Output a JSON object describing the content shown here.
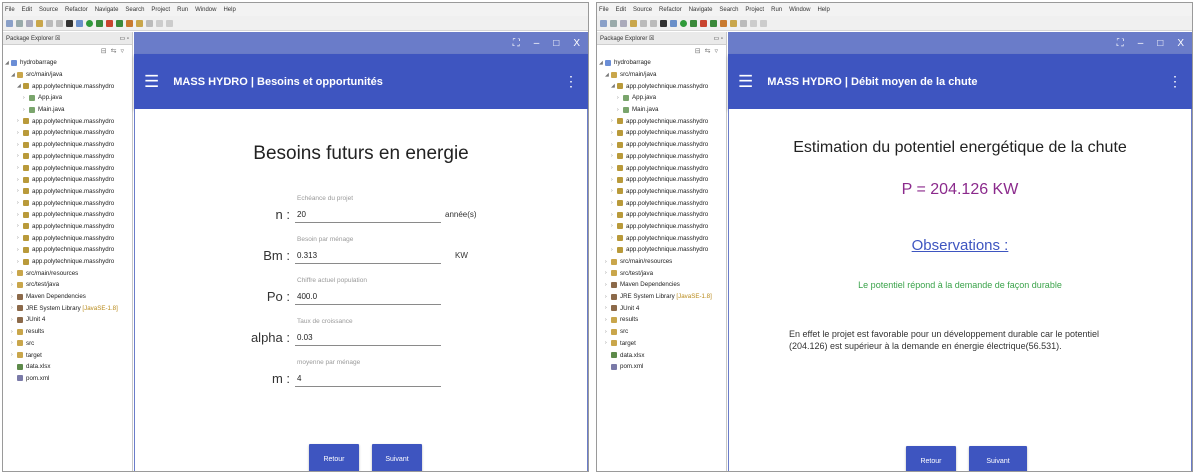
{
  "eclipse": {
    "menu": [
      "File",
      "Edit",
      "Source",
      "Refactor",
      "Navigate",
      "Search",
      "Project",
      "Run",
      "Window",
      "Help"
    ],
    "package_explorer_title": "Package Explorer ☒",
    "tree": {
      "project": "hydrobarrage",
      "src_main": "src/main/java",
      "package": "app.polytechnique.masshydro",
      "app_java": "App.java",
      "main_java": "Main.java",
      "subpackage": "app.polytechnique.masshydro",
      "resources": "src/main/resources",
      "src_test": "src/test/java",
      "maven": "Maven Dependencies",
      "jre": "JRE System Library",
      "jre_version": "[JavaSE-1.8]",
      "junit": "JUnit 4",
      "results": "results",
      "src": "src",
      "target": "target",
      "data": "data.xlsx",
      "pom": "pom.xml"
    }
  },
  "left_app": {
    "title": "MASS HYDRO | Besoins et opportunités",
    "heading": "Besoins futurs en energie",
    "fields": [
      {
        "label": "n :",
        "hint": "Echéance du projet",
        "value": "20",
        "unit": "année(s)"
      },
      {
        "label": "Bm :",
        "hint": "Besoin par ménage",
        "value": "0.313",
        "unit": "KW"
      },
      {
        "label": "Po :",
        "hint": "Chiffre actuel population",
        "value": "400.0",
        "unit": ""
      },
      {
        "label": "alpha :",
        "hint": "Taux de croissance",
        "value": "0.03",
        "unit": ""
      },
      {
        "label": "m :",
        "hint": "moyenne par ménage",
        "value": "4",
        "unit": ""
      }
    ],
    "back_label": "Retour",
    "next_label": "Suivant"
  },
  "right_app": {
    "title": "MASS HYDRO | Débit moyen de la chute",
    "heading": "Estimation du potentiel energétique de la chute",
    "power": "P = 204.126 KW",
    "observations_heading": "Observations :",
    "verdict": "Le potentiel répond à la demande de façon durable",
    "explanation": "En effet le projet est favorable pour un développement durable car le potentiel (204.126) est supérieur à la demande en énergie électrique(56.531).",
    "back_label": "Retour",
    "next_label": "Suivant"
  },
  "window_controls": {
    "expand": "⛶",
    "minimize": "–",
    "maximize": "□",
    "close": "X"
  },
  "colors": {
    "appbar": "#3e55c0",
    "window_bar": "#6a7cc9",
    "power_text": "#8b2a8c",
    "verdict_text": "#3aa34a"
  }
}
